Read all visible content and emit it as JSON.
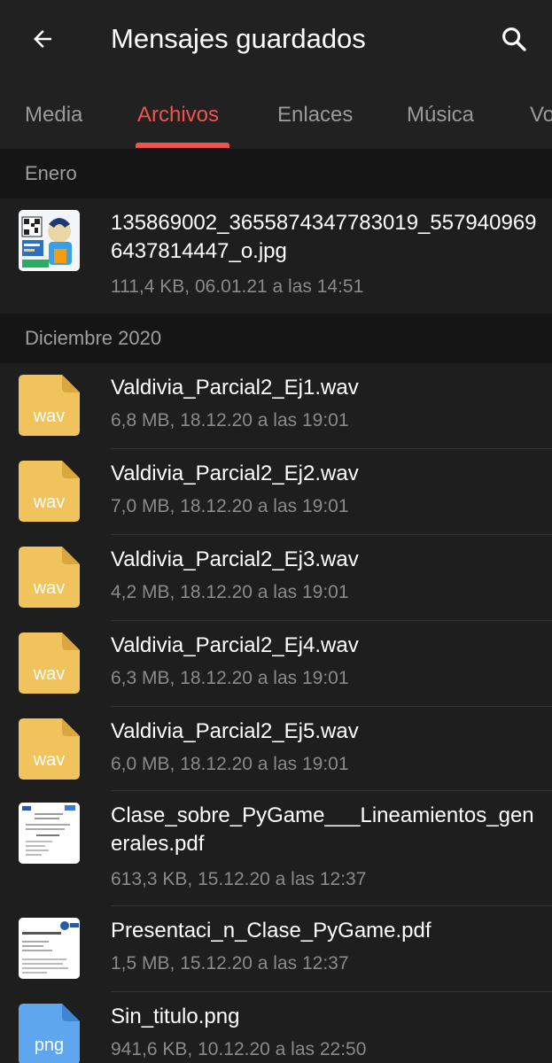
{
  "header": {
    "back_icon": "arrow-left-icon",
    "title": "Mensajes guardados",
    "search_icon": "search-icon"
  },
  "tabs": [
    {
      "label": "Media"
    },
    {
      "label": "Archivos",
      "active": true
    },
    {
      "label": "Enlaces"
    },
    {
      "label": "Música"
    },
    {
      "label": "Vo"
    }
  ],
  "colors": {
    "accent": "#ef5350",
    "background": "#1e1e1e",
    "section_bg": "#151515",
    "wav_icon": "#f0c35d",
    "png_icon": "#5ea6ee"
  },
  "sections": [
    {
      "label": "Enero",
      "files": [
        {
          "name": "135869002_3655874347783019_5579409696437814447_o.jpg",
          "meta": "111,4 KB, 06.01.21 a las 14:51",
          "thumb": "image"
        }
      ]
    },
    {
      "label": "Diciembre 2020",
      "files": [
        {
          "name": "Valdivia_Parcial2_Ej1.wav",
          "meta": "6,8 MB, 18.12.20 a las 19:01",
          "thumb": "wav",
          "ext": "wav"
        },
        {
          "name": "Valdivia_Parcial2_Ej2.wav",
          "meta": "7,0 MB, 18.12.20 a las 19:01",
          "thumb": "wav",
          "ext": "wav"
        },
        {
          "name": "Valdivia_Parcial2_Ej3.wav",
          "meta": "4,2 MB, 18.12.20 a las 19:01",
          "thumb": "wav",
          "ext": "wav"
        },
        {
          "name": "Valdivia_Parcial2_Ej4.wav",
          "meta": "6,3 MB, 18.12.20 a las 19:01",
          "thumb": "wav",
          "ext": "wav"
        },
        {
          "name": "Valdivia_Parcial2_Ej5.wav",
          "meta": "6,0 MB, 18.12.20 a las 19:01",
          "thumb": "wav",
          "ext": "wav"
        },
        {
          "name": "Clase_sobre_PyGame___Lineamientos_generales.pdf",
          "meta": "613,3 KB, 15.12.20 a las 12:37",
          "thumb": "document"
        },
        {
          "name": "Presentaci_n_Clase_PyGame.pdf",
          "meta": "1,5 MB, 15.12.20 a las 12:37",
          "thumb": "document"
        },
        {
          "name": "Sin_titulo.png",
          "meta": "941,6 KB, 10.12.20 a las 22:50",
          "thumb": "png",
          "ext": "png"
        }
      ]
    }
  ]
}
